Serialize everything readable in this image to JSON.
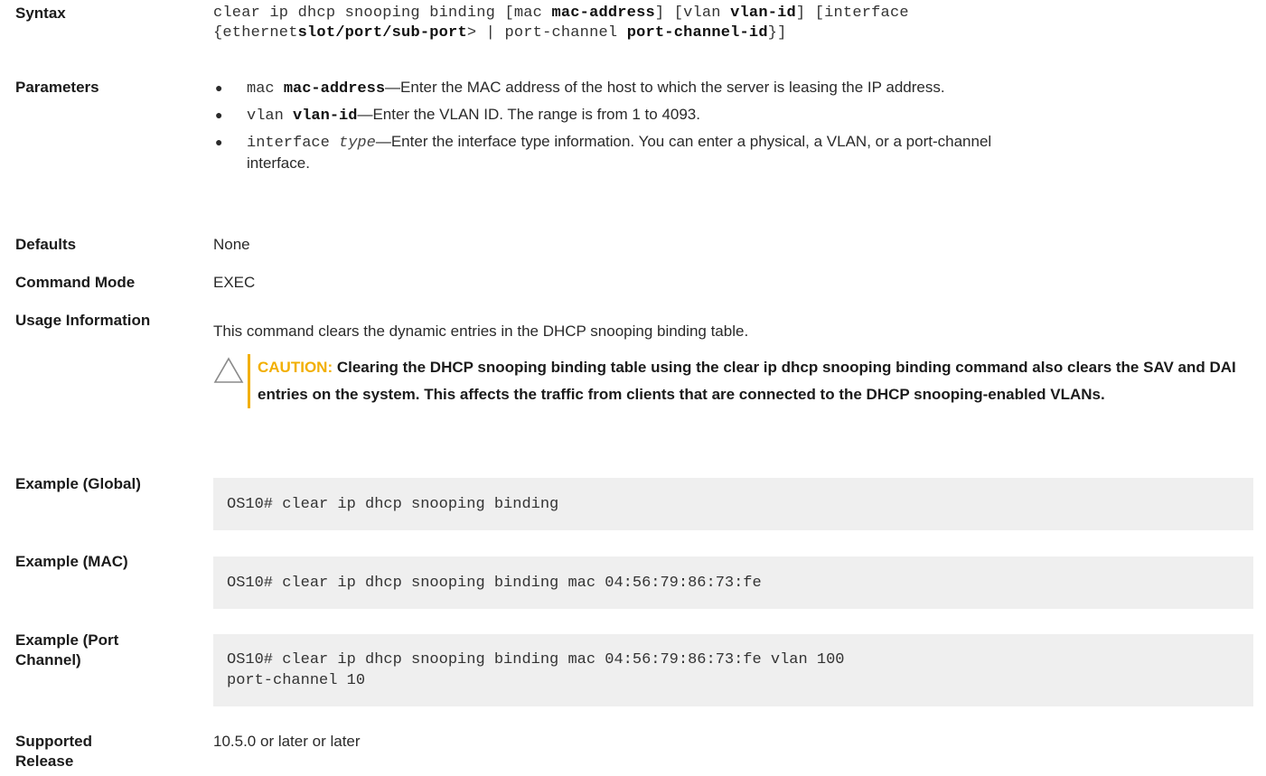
{
  "syntax": {
    "label": "Syntax",
    "line1_a": "clear ip dhcp snooping binding [mac ",
    "line1_b": "mac-address",
    "line1_c": "] [vlan ",
    "line1_d": "vlan-id",
    "line1_e": "] [interface",
    "line2_a": "{ethernet",
    "line2_b": "slot/port/sub-port",
    "line2_c": "> | port-channel ",
    "line2_d": "port-channel-id",
    "line2_e": "}]"
  },
  "parameters": {
    "label": "Parameters",
    "bullet": "●",
    "items": [
      {
        "kw": "mac ",
        "arg": "mac-address",
        "text": "—Enter the MAC address of the host to which the server is leasing the IP address."
      },
      {
        "kw": "vlan ",
        "arg": "vlan-id",
        "text": "—Enter the VLAN ID. The range is from 1 to 4093."
      },
      {
        "kw": "interface ",
        "arg": "type",
        "text": "—Enter the interface type information. You can enter a physical, a VLAN, or a port-channel interface."
      }
    ]
  },
  "defaults": {
    "label": "Defaults",
    "value": "None"
  },
  "command_mode": {
    "label": "Command Mode",
    "value": "EXEC"
  },
  "usage": {
    "label": "Usage Information",
    "text": "This command clears the dynamic entries in the DHCP snooping binding table.",
    "caution_title": "CAUTION:",
    "caution_text": " Clearing the DHCP snooping binding table using the clear ip dhcp snooping binding command also clears the SAV and DAI entries on the system. This affects the traffic from clients that are connected to the DHCP snooping-enabled VLANs."
  },
  "examples": [
    {
      "label": "Example (Global)",
      "code_lines": [
        "OS10# clear ip dhcp snooping binding"
      ]
    },
    {
      "label": "Example (MAC)",
      "code_lines": [
        "OS10# clear ip dhcp snooping binding mac 04:56:79:86:73:fe"
      ]
    },
    {
      "label": "Example (Port Channel)",
      "code_lines": [
        "OS10# clear ip dhcp snooping binding mac 04:56:79:86:73:fe  vlan 100",
        "port-channel 10"
      ]
    }
  ],
  "supported_release": {
    "label": "Supported Release",
    "value": "10.5.0 or later or later"
  },
  "colors": {
    "caution_accent": "#f2af00",
    "code_bg": "#efefef"
  },
  "icons": {
    "caution": "warning-triangle-icon"
  }
}
